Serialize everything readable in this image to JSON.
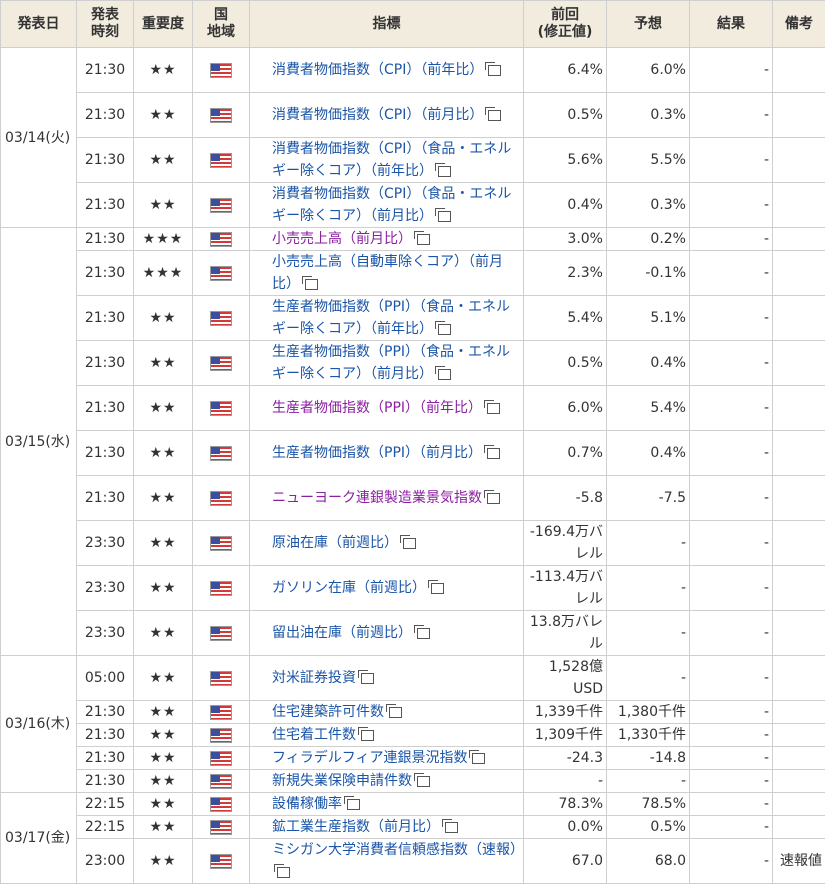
{
  "headers": {
    "date": "発表日",
    "time": "発表\n時刻",
    "importance": "重要度",
    "country": "国\n地域",
    "indicator": "指標",
    "previous": "前回\n(修正値)",
    "forecast": "予想",
    "result": "結果",
    "note": "備考"
  },
  "groups": [
    {
      "date": "03/14(火)",
      "rows": [
        {
          "time": "21:30",
          "stars": "★★",
          "indicator": "消費者物価指数（CPI）（前年比）",
          "visited": false,
          "previous": "6.4%",
          "forecast": "6.0%",
          "result": "-",
          "note": "",
          "size": "tall"
        },
        {
          "time": "21:30",
          "stars": "★★",
          "indicator": "消費者物価指数（CPI）（前月比）",
          "visited": false,
          "previous": "0.5%",
          "forecast": "0.3%",
          "result": "-",
          "note": "",
          "size": "tall"
        },
        {
          "time": "21:30",
          "stars": "★★",
          "indicator": "消費者物価指数（CPI）（食品・エネルギー除くコア）（前年比）",
          "visited": false,
          "previous": "5.6%",
          "forecast": "5.5%",
          "result": "-",
          "note": "",
          "size": "tall"
        },
        {
          "time": "21:30",
          "stars": "★★",
          "indicator": "消費者物価指数（CPI）（食品・エネルギー除くコア）（前月比）",
          "visited": false,
          "previous": "0.4%",
          "forecast": "0.3%",
          "result": "-",
          "note": "",
          "size": "tall"
        }
      ]
    },
    {
      "date": "03/15(水)",
      "rows": [
        {
          "time": "21:30",
          "stars": "★★★",
          "indicator": "小売売上高（前月比）",
          "visited": true,
          "previous": "3.0%",
          "forecast": "0.2%",
          "result": "-",
          "note": "",
          "size": "short"
        },
        {
          "time": "21:30",
          "stars": "★★★",
          "indicator": "小売売上高（自動車除くコア）（前月比）",
          "visited": false,
          "previous": "2.3%",
          "forecast": "-0.1%",
          "result": "-",
          "note": "",
          "size": "tall"
        },
        {
          "time": "21:30",
          "stars": "★★",
          "indicator": "生産者物価指数（PPI）（食品・エネルギー除くコア）（前年比）",
          "visited": false,
          "previous": "5.4%",
          "forecast": "5.1%",
          "result": "-",
          "note": "",
          "size": "tall"
        },
        {
          "time": "21:30",
          "stars": "★★",
          "indicator": "生産者物価指数（PPI）（食品・エネルギー除くコア）（前月比）",
          "visited": false,
          "previous": "0.5%",
          "forecast": "0.4%",
          "result": "-",
          "note": "",
          "size": "tall"
        },
        {
          "time": "21:30",
          "stars": "★★",
          "indicator": "生産者物価指数（PPI）（前年比）",
          "visited": true,
          "previous": "6.0%",
          "forecast": "5.4%",
          "result": "-",
          "note": "",
          "size": "tall"
        },
        {
          "time": "21:30",
          "stars": "★★",
          "indicator": "生産者物価指数（PPI）（前月比）",
          "visited": false,
          "previous": "0.7%",
          "forecast": "0.4%",
          "result": "-",
          "note": "",
          "size": "tall"
        },
        {
          "time": "21:30",
          "stars": "★★",
          "indicator": "ニューヨーク連銀製造業景気指数",
          "visited": true,
          "previous": "-5.8",
          "forecast": "-7.5",
          "result": "-",
          "note": "",
          "size": "tall"
        },
        {
          "time": "23:30",
          "stars": "★★",
          "indicator": "原油在庫（前週比）",
          "visited": false,
          "previous": "-169.4万バレル",
          "forecast": "-",
          "result": "-",
          "note": "",
          "size": "tall"
        },
        {
          "time": "23:30",
          "stars": "★★",
          "indicator": "ガソリン在庫（前週比）",
          "visited": false,
          "previous": "-113.4万バレル",
          "forecast": "-",
          "result": "-",
          "note": "",
          "size": "tall"
        },
        {
          "time": "23:30",
          "stars": "★★",
          "indicator": "留出油在庫（前週比）",
          "visited": false,
          "previous": "13.8万バレル",
          "forecast": "-",
          "result": "-",
          "note": "",
          "size": "tall"
        }
      ]
    },
    {
      "date": "03/16(木)",
      "rows": [
        {
          "time": "05:00",
          "stars": "★★",
          "indicator": "対米証券投資",
          "visited": false,
          "previous": "1,528億USD",
          "forecast": "-",
          "result": "-",
          "note": "",
          "size": "tall"
        },
        {
          "time": "21:30",
          "stars": "★★",
          "indicator": "住宅建築許可件数",
          "visited": false,
          "previous": "1,339千件",
          "forecast": "1,380千件",
          "result": "-",
          "note": "",
          "size": "short"
        },
        {
          "time": "21:30",
          "stars": "★★",
          "indicator": "住宅着工件数",
          "visited": false,
          "previous": "1,309千件",
          "forecast": "1,330千件",
          "result": "-",
          "note": "",
          "size": "short"
        },
        {
          "time": "21:30",
          "stars": "★★",
          "indicator": "フィラデルフィア連銀景況指数",
          "visited": false,
          "previous": "-24.3",
          "forecast": "-14.8",
          "result": "-",
          "note": "",
          "size": "short"
        },
        {
          "time": "21:30",
          "stars": "★★",
          "indicator": "新規失業保険申請件数",
          "visited": false,
          "previous": "-",
          "forecast": "-",
          "result": "-",
          "note": "",
          "size": "short"
        }
      ]
    },
    {
      "date": "03/17(金)",
      "rows": [
        {
          "time": "22:15",
          "stars": "★★",
          "indicator": "設備稼働率",
          "visited": false,
          "previous": "78.3%",
          "forecast": "78.5%",
          "result": "-",
          "note": "",
          "size": "short"
        },
        {
          "time": "22:15",
          "stars": "★★",
          "indicator": "鉱工業生産指数（前月比）",
          "visited": false,
          "previous": "0.0%",
          "forecast": "0.5%",
          "result": "-",
          "note": "",
          "size": "short"
        },
        {
          "time": "23:00",
          "stars": "★★",
          "indicator": "ミシガン大学消費者信頼感指数（速報）",
          "visited": false,
          "previous": "67.0",
          "forecast": "68.0",
          "result": "-",
          "note": "速報値",
          "size": "tall"
        }
      ]
    }
  ]
}
